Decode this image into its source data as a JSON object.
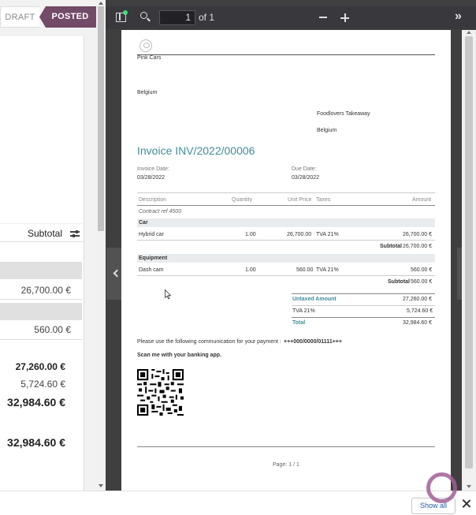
{
  "status": {
    "draft": "DRAFT",
    "posted": "POSTED"
  },
  "lines_panel": {
    "subtotal_header": "Subtotal",
    "line1_subtotal": "26,700.00 €",
    "line2_subtotal": "560.00 €",
    "untaxed": "27,260.00 €",
    "tax": "5,724.60 €",
    "total": "32,984.60 €",
    "amount_due": "32,984.60 €"
  },
  "viewer": {
    "page_number": "1",
    "page_count": "of 1"
  },
  "pdf": {
    "company": "Pink Cars",
    "company_country": "Belgium",
    "customer_name": "Foodlovers Takeaway",
    "customer_country": "Belgium",
    "title": "Invoice INV/2022/00006",
    "invoice_date_label": "Invoice Date:",
    "invoice_date": "03/28/2022",
    "due_date_label": "Due Date:",
    "due_date": "03/28/2022",
    "columns": {
      "description": "Description",
      "quantity": "Quantity",
      "unit_price": "Unit Price",
      "taxes": "Taxes",
      "amount": "Amount"
    },
    "contract_ref": "Contract ref 4500",
    "section1": "Car",
    "line1": {
      "desc": "Hybrid car",
      "qty": "1.00",
      "price": "26,700.00",
      "tax": "TVA 21%",
      "amount": "26,700.00 €"
    },
    "subtotal1_label": "Subtotal",
    "subtotal1_value": "26,700.00 €",
    "section2": "Equipment",
    "line2": {
      "desc": "Dash cam",
      "qty": "1.00",
      "price": "560.00",
      "tax": "TVA 21%",
      "amount": "560.00 €"
    },
    "subtotal2_label": "Subtotal",
    "subtotal2_value": "560.00 €",
    "untaxed_label": "Untaxed Amount",
    "untaxed_value": "27,260.00 €",
    "tax_label": "TVA 21%",
    "tax_value": "5,724.60 €",
    "total_label": "Total",
    "total_value": "32,984.60 €",
    "communication_text": "Please use the following communication for your payment :",
    "communication_ref": "+++000/0000/01111+++",
    "scan_text": "Scan me with your banking app.",
    "footer_page": "Page: 1 / 1"
  },
  "bottom": {
    "show_all": "Show all"
  },
  "colors": {
    "brand": "#714b67",
    "title": "#3e8e9a",
    "toolbar": "#38383d",
    "link": "#1f5fa8"
  },
  "icons": [
    "sidebar-toggle-icon",
    "search-icon",
    "zoom-out-icon",
    "zoom-in-icon",
    "more-tools-icon",
    "adjust-columns-icon",
    "chevron-left-icon",
    "chevron-right-icon",
    "close-icon",
    "qr-code",
    "company-logo"
  ]
}
